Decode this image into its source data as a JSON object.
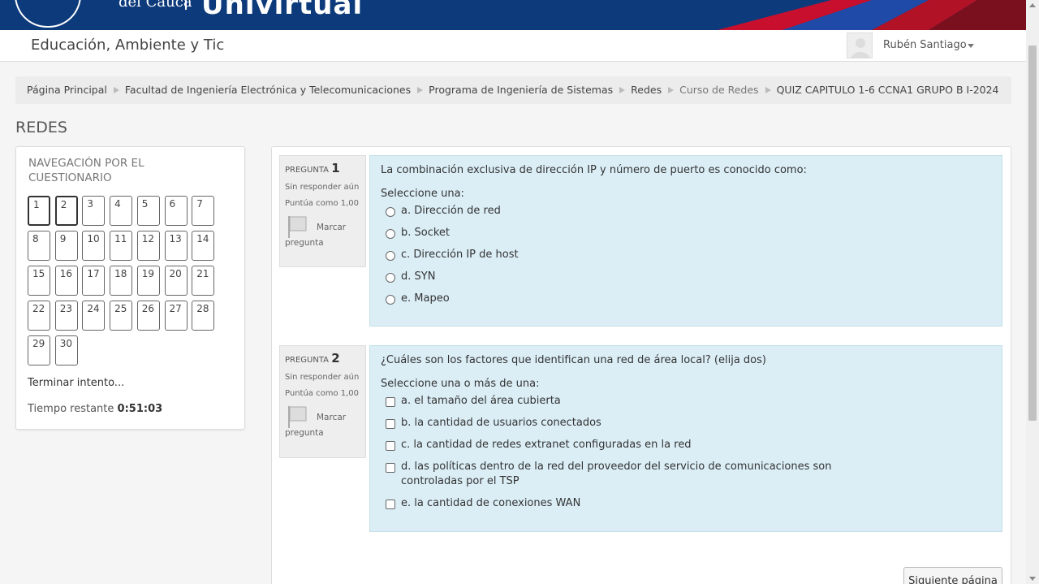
{
  "banner": {
    "unit_name": "del Cauca",
    "brand": "Univirtual"
  },
  "header": {
    "site_name": "Educación, Ambiente y Tic",
    "user_name": "Rubén Santiago"
  },
  "breadcrumb": [
    "Página Principal",
    "Facultad de Ingeniería Electrónica y Telecomunicaciones",
    "Programa de Ingeniería de Sistemas",
    "Redes",
    "Curso de Redes",
    "QUIZ CAPITULO 1-6 CCNA1 GRUPO B I-2024"
  ],
  "page_title": "REDES",
  "quiz_nav": {
    "title": "NAVEGACIÓN POR EL CUESTIONARIO",
    "buttons": [
      "1",
      "2",
      "3",
      "4",
      "5",
      "6",
      "7",
      "8",
      "9",
      "10",
      "11",
      "12",
      "13",
      "14",
      "15",
      "16",
      "17",
      "18",
      "19",
      "20",
      "21",
      "22",
      "23",
      "24",
      "25",
      "26",
      "27",
      "28",
      "29",
      "30"
    ],
    "finish": "Terminar intento...",
    "time_label": "Tiempo restante",
    "time_value": "0:51:03"
  },
  "questions": [
    {
      "label": "PREGUNTA",
      "number": "1",
      "status": "Sin responder aún",
      "grade": "Puntúa como 1,00",
      "flag_line1": "Marcar",
      "flag_line2": "pregunta",
      "text": "La combinación exclusiva de dirección IP y número de puerto es conocido como:",
      "prompt": "Seleccione una:",
      "options": [
        "a. Dirección de red",
        "b. Socket",
        "c. Dirección IP de host",
        "d. SYN",
        "e. Mapeo"
      ]
    },
    {
      "label": "PREGUNTA",
      "number": "2",
      "status": "Sin responder aún",
      "grade": "Puntúa como 1,00",
      "flag_line1": "Marcar",
      "flag_line2": "pregunta",
      "text": "¿Cuáles son los factores que identifican una red de área local? (elija dos)",
      "prompt": "Seleccione una o más de una:",
      "options": [
        "a. el tamaño del área cubierta",
        "b. la cantidad de usuarios conectados",
        "c. la cantidad de redes extranet configuradas en la red",
        "d. las políticas dentro de la red del proveedor del servicio de comunicaciones son",
        "e. la cantidad de conexiones WAN"
      ],
      "option_d_cont": "controladas por el TSP"
    }
  ],
  "next_button": "Siguiente página"
}
